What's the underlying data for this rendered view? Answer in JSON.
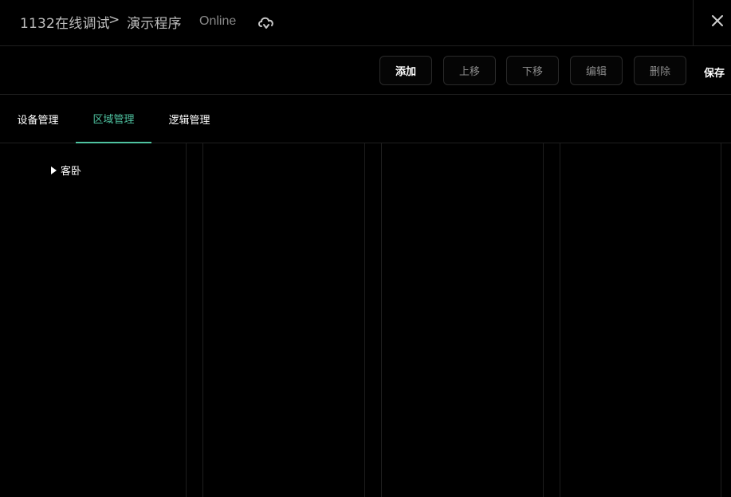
{
  "header": {
    "project": "1132在线调试",
    "separator": ">",
    "program": "演示程序",
    "status": "Online",
    "cloud_icon": "cloud-sync-icon",
    "close_icon": "close-icon"
  },
  "toolbar": {
    "add_label": "添加",
    "up_label": "上移",
    "down_label": "下移",
    "edit_label": "编辑",
    "delete_label": "删除",
    "save_label": "保存"
  },
  "tabs": [
    {
      "label": "设备管理",
      "active": false
    },
    {
      "label": "区域管理",
      "active": true
    },
    {
      "label": "逻辑管理",
      "active": false
    }
  ],
  "tree": {
    "items": [
      {
        "label": "客卧",
        "expanded": false
      }
    ]
  },
  "colors": {
    "accent": "#4fc3a1",
    "background": "#000000",
    "border": "#2a2a2a"
  }
}
